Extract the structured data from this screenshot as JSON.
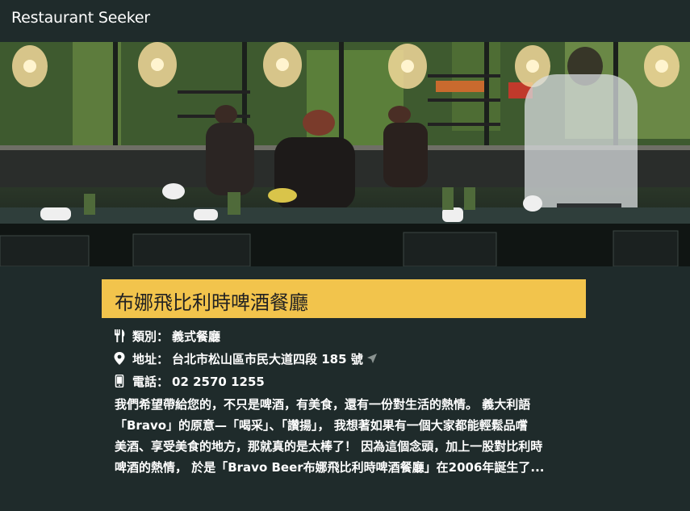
{
  "app": {
    "title": "Restaurant Seeker"
  },
  "hero": {
    "image_name": "restaurant-kitchen-photo"
  },
  "restaurant": {
    "name": "布娜飛比利時啤酒餐廳",
    "category_label": "類別：",
    "category": "義式餐廳",
    "address_label": "地址：",
    "address": "台北市松山區市民大道四段 185 號",
    "phone_label": "電話：",
    "phone": "02 2570 1255",
    "description_lines": [
      "我們希望帶給您的，不只是啤酒，有美食，還有一份對生活的熱情。 義大利語",
      "「Bravo」的原意—「喝采」、「讚揚」， 我想著如果有一個大家都能輕鬆品嚐",
      "美酒、享受美食的地方，那就真的是太棒了！ 因為這個念頭，加上一股對比利時",
      "啤酒的熱情， 於是「Bravo Beer布娜飛比利時啤酒餐廳」在2006年誕生了..."
    ]
  },
  "colors": {
    "background": "#1f2b2b",
    "accent": "#f2c44c",
    "title_text": "#222222"
  },
  "icons": {
    "category": "utensils-icon",
    "address": "map-marker-icon",
    "phone": "mobile-phone-icon",
    "navigate": "location-arrow-icon"
  }
}
